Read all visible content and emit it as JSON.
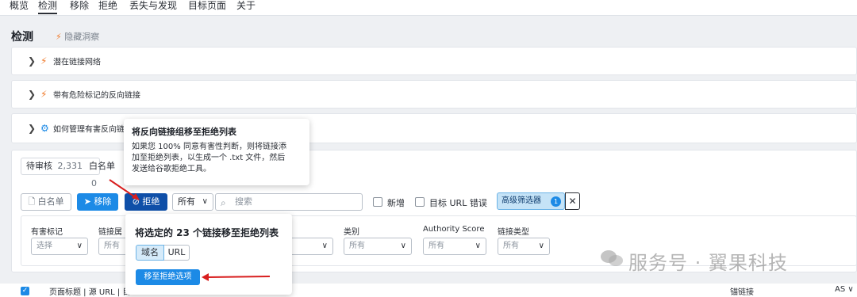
{
  "nav": {
    "tabs": [
      "概览",
      "检测",
      "移除",
      "拒绝",
      "丢失与发现",
      "目标页面",
      "关于"
    ],
    "active_index": 1
  },
  "page": {
    "title": "检测",
    "subnote": "隐藏洞察"
  },
  "panels": [
    {
      "label": "潜在链接网络",
      "icon": "bolt-icon"
    },
    {
      "label": "带有危险标记的反向链接",
      "icon": "bolt-icon"
    },
    {
      "label": "如何管理有害反向链",
      "icon": "gear-icon"
    }
  ],
  "tooltip": {
    "title": "将反向链接组移至拒绝列表",
    "lines": [
      "如果您 100% 同意有害性判断，则将链接添",
      "加至拒绝列表，以生成一个 .txt 文件，然后",
      "发送给谷歌拒绝工具。"
    ]
  },
  "counts": {
    "pending_label": "待审核",
    "pending_value": "2,331",
    "whitelist_label": "白名单",
    "whitelist_value": "0"
  },
  "toolbar": {
    "whitelist": "白名单",
    "remove": "移除",
    "disavow": "拒绝",
    "scope": "所有",
    "search_placeholder": "搜索",
    "new_label": "新增",
    "target_url_error": "目标 URL 错误",
    "advanced_filter": "高级筛选器",
    "advanced_count": "1"
  },
  "filters": {
    "toxic_label": "有害标记",
    "toxic_value": "选择",
    "link_attr_label": "链接属",
    "link_attr_value": "所有",
    "category_label": "类别",
    "category_value": "所有",
    "authority_label": "Authority Score",
    "authority_value": "所有",
    "link_type_label": "链接类型",
    "link_type_value": "所有"
  },
  "popup": {
    "title": "将选定的 23 个链接移至拒绝列表",
    "seg_domain": "域名",
    "seg_url": "URL",
    "move_button": "移至拒绝选项"
  },
  "table_header": {
    "col1": "页面标题 | 源 URL | 目",
    "col2": "锚链接",
    "col3": "AS"
  },
  "watermark": "服务号 · 翼果科技",
  "colors": {
    "accent_blue": "#1c8ae6",
    "dark_blue": "#0f4fa8",
    "bolt_orange": "#f07a2a",
    "arrow_red": "#d81e1e"
  }
}
